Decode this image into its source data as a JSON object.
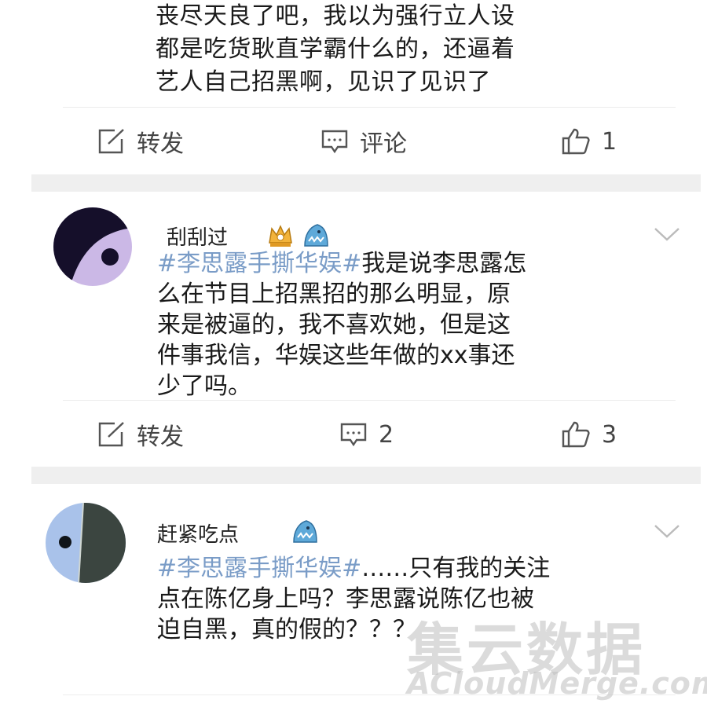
{
  "post": {
    "lines": [
      "丧尽天良了吧，我以为强行立人设",
      "都是吃货耿直学霸什么的，还逼着",
      "艺人自己招黑啊，见识了见识了"
    ]
  },
  "actions": {
    "repost_label": "转发",
    "comment_label": "评论",
    "post_like_count": "1"
  },
  "comments": [
    {
      "username": "刮刮过",
      "hashtag": "#李思露手撕华娱#",
      "lines": [
        "我是说李思露怎",
        "么在节目上招黑招的那么明显，原",
        "来是被逼的，我不喜欢她，但是这",
        "件事我信，华娱这些年做的xx事还",
        "少了吗。"
      ],
      "repost_label": "转发",
      "comment_count": "2",
      "like_count": "3"
    },
    {
      "username": "赶紧吃点",
      "hashtag": "#李思露手撕华娱#",
      "lines": [
        "……只有我的关注",
        "点在陈亿身上吗？李思露说陈亿也被",
        "迫自黑，真的假的？？？"
      ]
    }
  ],
  "watermark": {
    "cn": "集云数据",
    "en": "ACloudMerge.com"
  },
  "icons": [
    "repost-icon",
    "comment-icon",
    "like-icon",
    "chevron-down-icon",
    "crown-badge-icon",
    "shark-badge-icon"
  ],
  "colors": {
    "hashtag": "#7a9cc7",
    "divider": "#efefef",
    "icon": "#555555"
  }
}
